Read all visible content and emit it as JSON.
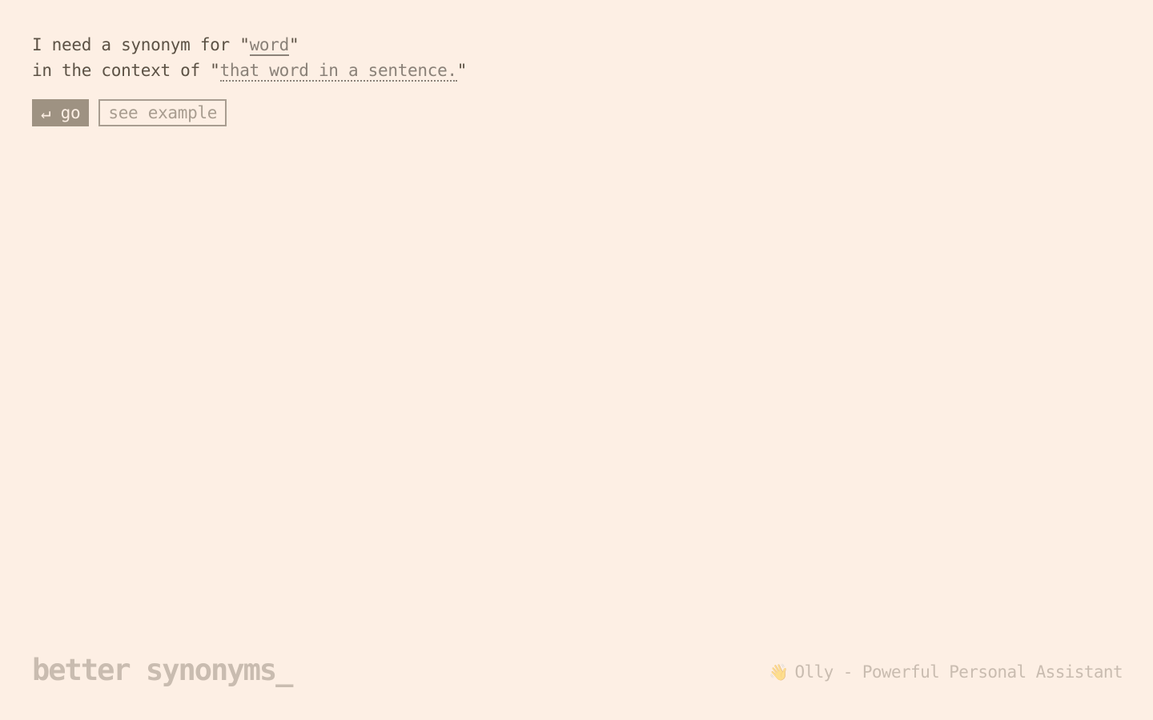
{
  "prompt": {
    "line1_prefix": "I need a synonym for \"",
    "word_value": "word",
    "line1_suffix": "\"",
    "line2_prefix": "in the context of \"",
    "context_value": "that word in a sentence.",
    "line2_suffix": "\""
  },
  "actions": {
    "go_label": "↵ go",
    "example_label": "see example"
  },
  "footer": {
    "logo_text": "better synonyms_",
    "promo_icon": "👋",
    "promo_text": "Olly - Powerful Personal Assistant"
  },
  "colors": {
    "background": "#fdefe4",
    "text": "#5c5245",
    "button": "#9e9282",
    "muted": "#c9bcb0"
  }
}
